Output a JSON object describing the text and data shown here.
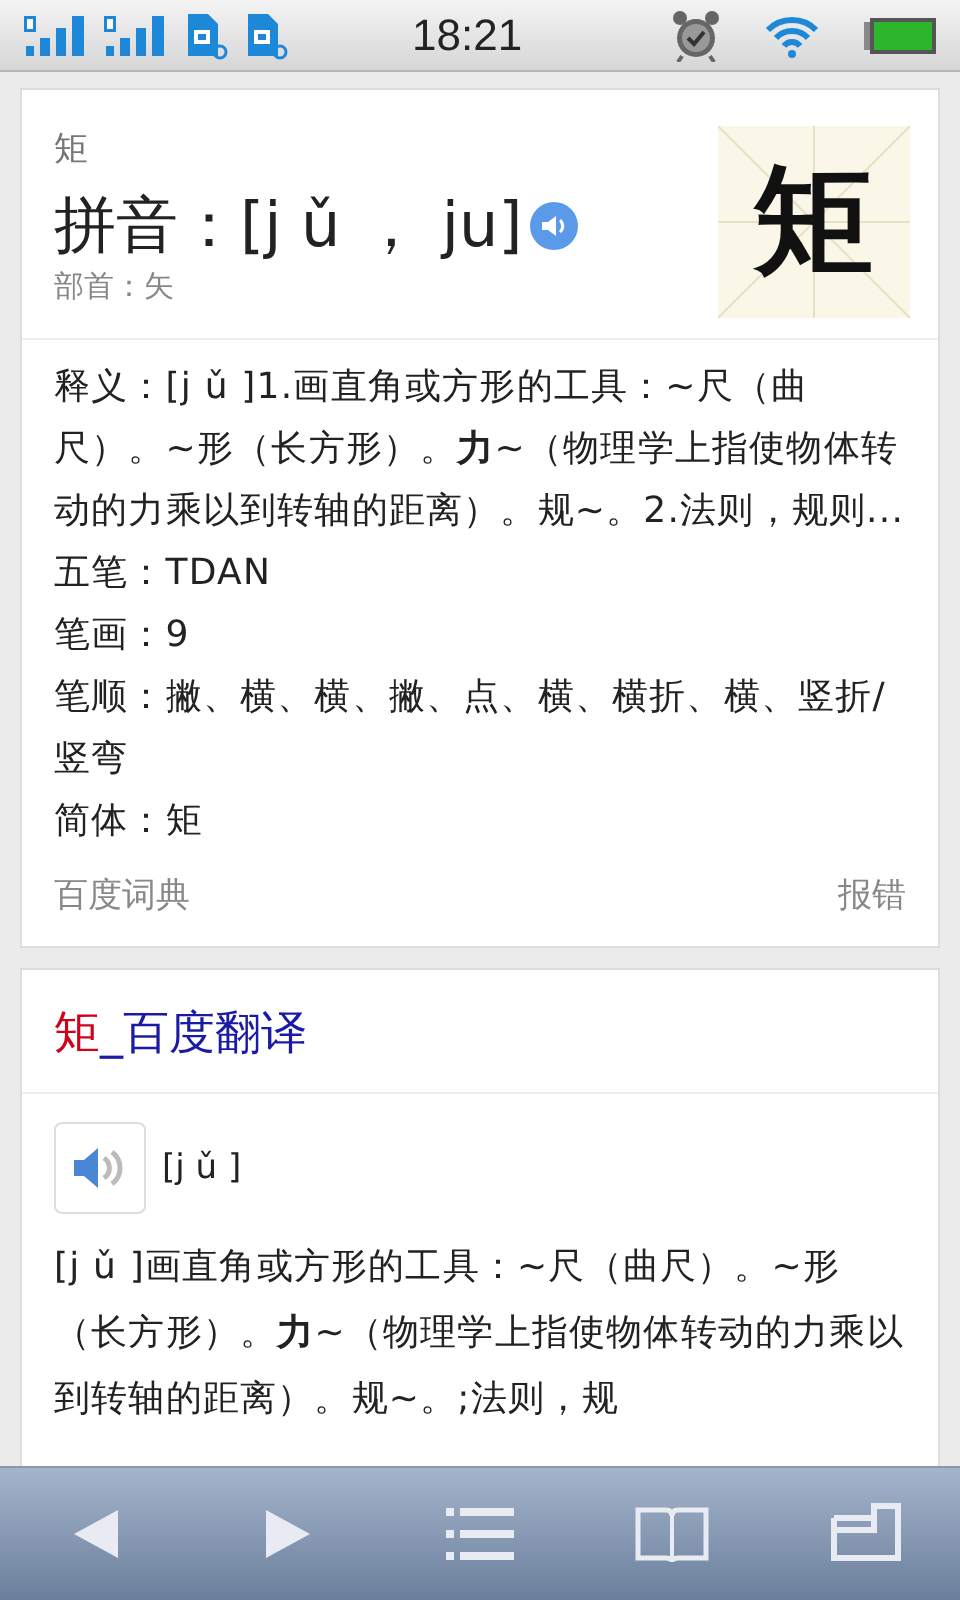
{
  "status_bar": {
    "time": "18:21"
  },
  "dict_card": {
    "character": "矩",
    "pinyin": "拼音：[j ǔ ， ju]",
    "radical": "部首：矢",
    "glyph": "矩",
    "lines": [
      "释义：[j ǔ ]1.画直角或方形的工具：~尺（曲尺）。~形（长方形）。**力**~（物理学上指使物体转动的力乘以到转轴的距离）。规~。2.法则，规则...",
      "五笔：TDAN",
      "笔画：9",
      "笔顺：撇、横、横、撇、点、横、横折、横、竖折/竖弯",
      "简体：矩"
    ],
    "source": "百度词典",
    "report": "报错"
  },
  "translate_card": {
    "title_highlight": "矩",
    "title_rest": "_百度翻译",
    "phonetic": "[j ǔ ]",
    "definition": "[j ǔ ]画直角或方形的工具：~尺（曲尺）。~形（长方形）。**力**~（物理学上指使物体转动的力乘以到转轴的距离）。规~。;法则，规"
  },
  "toolbar": [
    {
      "kind": "back"
    },
    {
      "kind": "forward"
    },
    {
      "kind": "list"
    },
    {
      "kind": "bookmarks"
    },
    {
      "kind": "tabs"
    }
  ]
}
